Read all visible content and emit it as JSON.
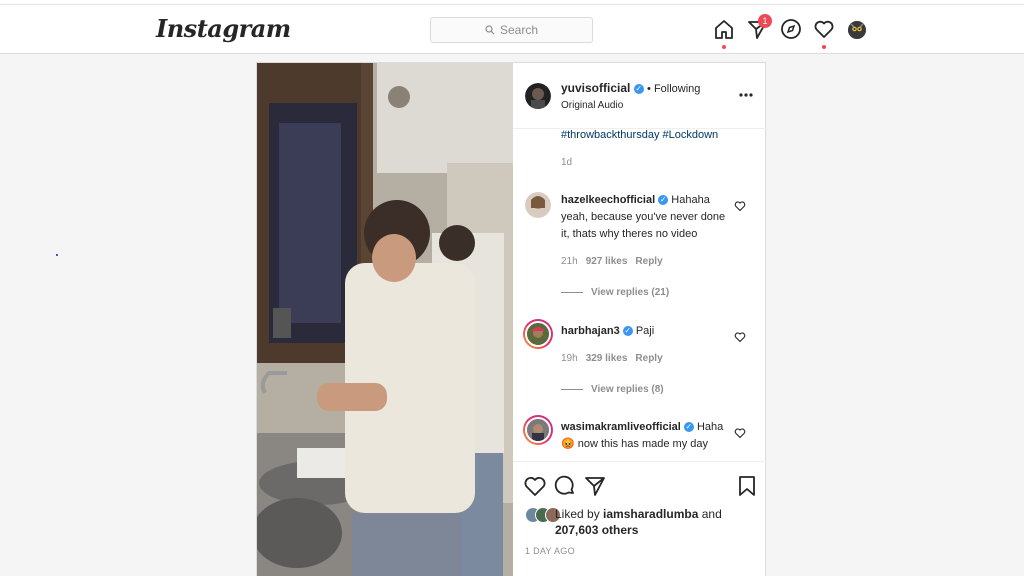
{
  "app": {
    "logo": "Instagram"
  },
  "search": {
    "placeholder": "Search"
  },
  "nav": {
    "notification_count": "1",
    "icons": [
      "home-icon",
      "direct-icon",
      "explore-icon",
      "activity-icon",
      "profile-avatar"
    ]
  },
  "post": {
    "author": "yuvisofficial",
    "following": "• Following",
    "audio": "Original Audio",
    "caption_tags": "#throwbackthursday #Lockdown",
    "caption_age": "1d",
    "comments": [
      {
        "user": "hazelkeechofficial",
        "text": "Hahaha yeah, because you've never done it, thats why theres no video",
        "age": "21h",
        "likes": "927 likes",
        "reply": "Reply",
        "view_replies": "View replies (21)"
      },
      {
        "user": "harbhajan3",
        "text": "Paji",
        "age": "19h",
        "likes": "329 likes",
        "reply": "Reply",
        "view_replies": "View replies (8)"
      },
      {
        "user": "wasimakramliveofficial",
        "text": "Haha 😡 now this has made my day",
        "age": "",
        "likes": "",
        "reply": "",
        "view_replies": ""
      }
    ],
    "liked_by_prefix": "Liked by ",
    "liked_by_user": "iamsharadlumba",
    "liked_by_and": " and",
    "liked_by_count": "207,603 others",
    "timestamp": "1 DAY AGO"
  },
  "colors": {
    "notification": "#ed4956",
    "verified": "#3897f0",
    "hashtag": "#00376b"
  }
}
